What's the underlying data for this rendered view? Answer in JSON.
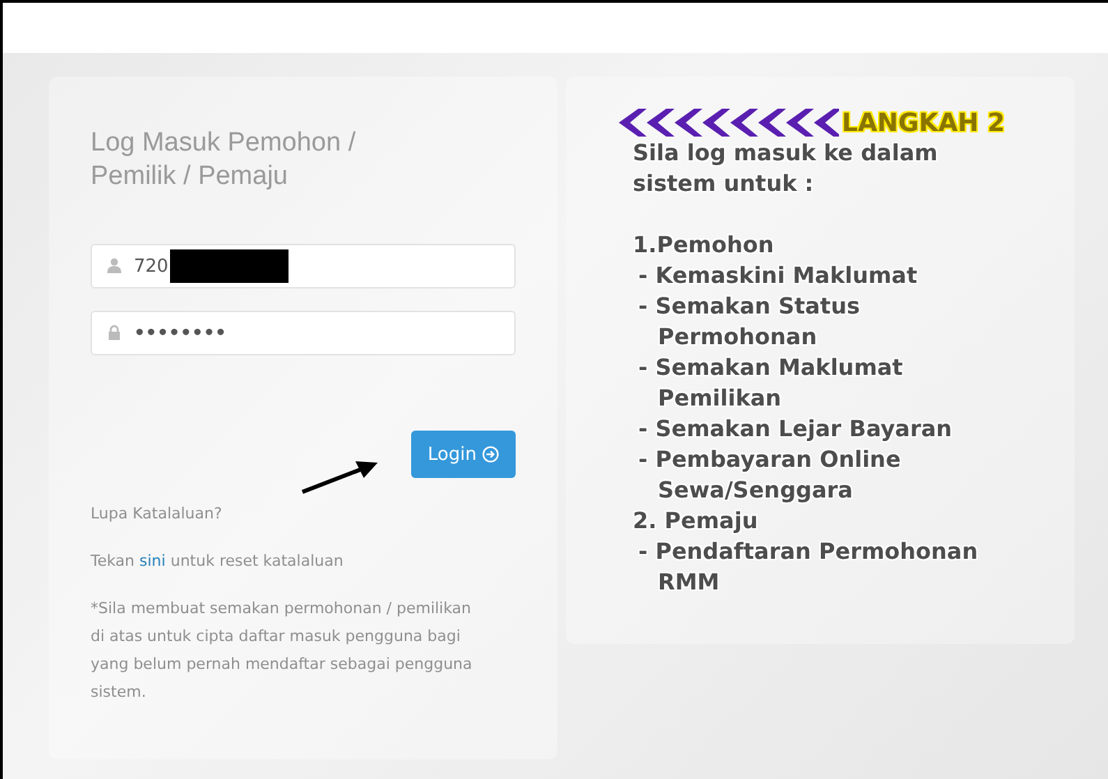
{
  "login_form": {
    "title": "Log Masuk Pemohon / Pemilik / Pemaju",
    "username": {
      "value": "720",
      "redacted": true
    },
    "password": {
      "value": "••••••••"
    },
    "login_button": "Login",
    "forgot_link": "Lupa Katalaluan?",
    "reset_text": {
      "before": "Tekan",
      "link": "sini",
      "after": "untuk reset katalaluan"
    },
    "note": "*Sila membuat semakan permohonan / pemilikan di atas untuk cipta daftar masuk pengguna bagi yang belum pernah mendaftar sebagai pengguna sistem."
  },
  "info_panel": {
    "step": "LANGKAH 2",
    "intro": [
      "Sila log masuk ke dalam",
      "sistem untuk :"
    ],
    "lines": [
      {
        "kind": "heading",
        "text": "1.Pemohon"
      },
      {
        "kind": "item",
        "text": "- Kemaskini Maklumat"
      },
      {
        "kind": "item",
        "text": "- Semakan Status"
      },
      {
        "kind": "cont",
        "text": "Permohonan"
      },
      {
        "kind": "item",
        "text": "- Semakan Maklumat"
      },
      {
        "kind": "cont",
        "text": "Pemilikan"
      },
      {
        "kind": "item",
        "text": "- Semakan Lejar Bayaran"
      },
      {
        "kind": "item",
        "text": "- Pembayaran Online"
      },
      {
        "kind": "cont",
        "text": "Sewa/Senggara"
      },
      {
        "kind": "heading",
        "text": "2. Pemaju"
      },
      {
        "kind": "item",
        "text": "- Pendaftaran Permohonan"
      },
      {
        "kind": "cont",
        "text": "RMM"
      }
    ]
  }
}
